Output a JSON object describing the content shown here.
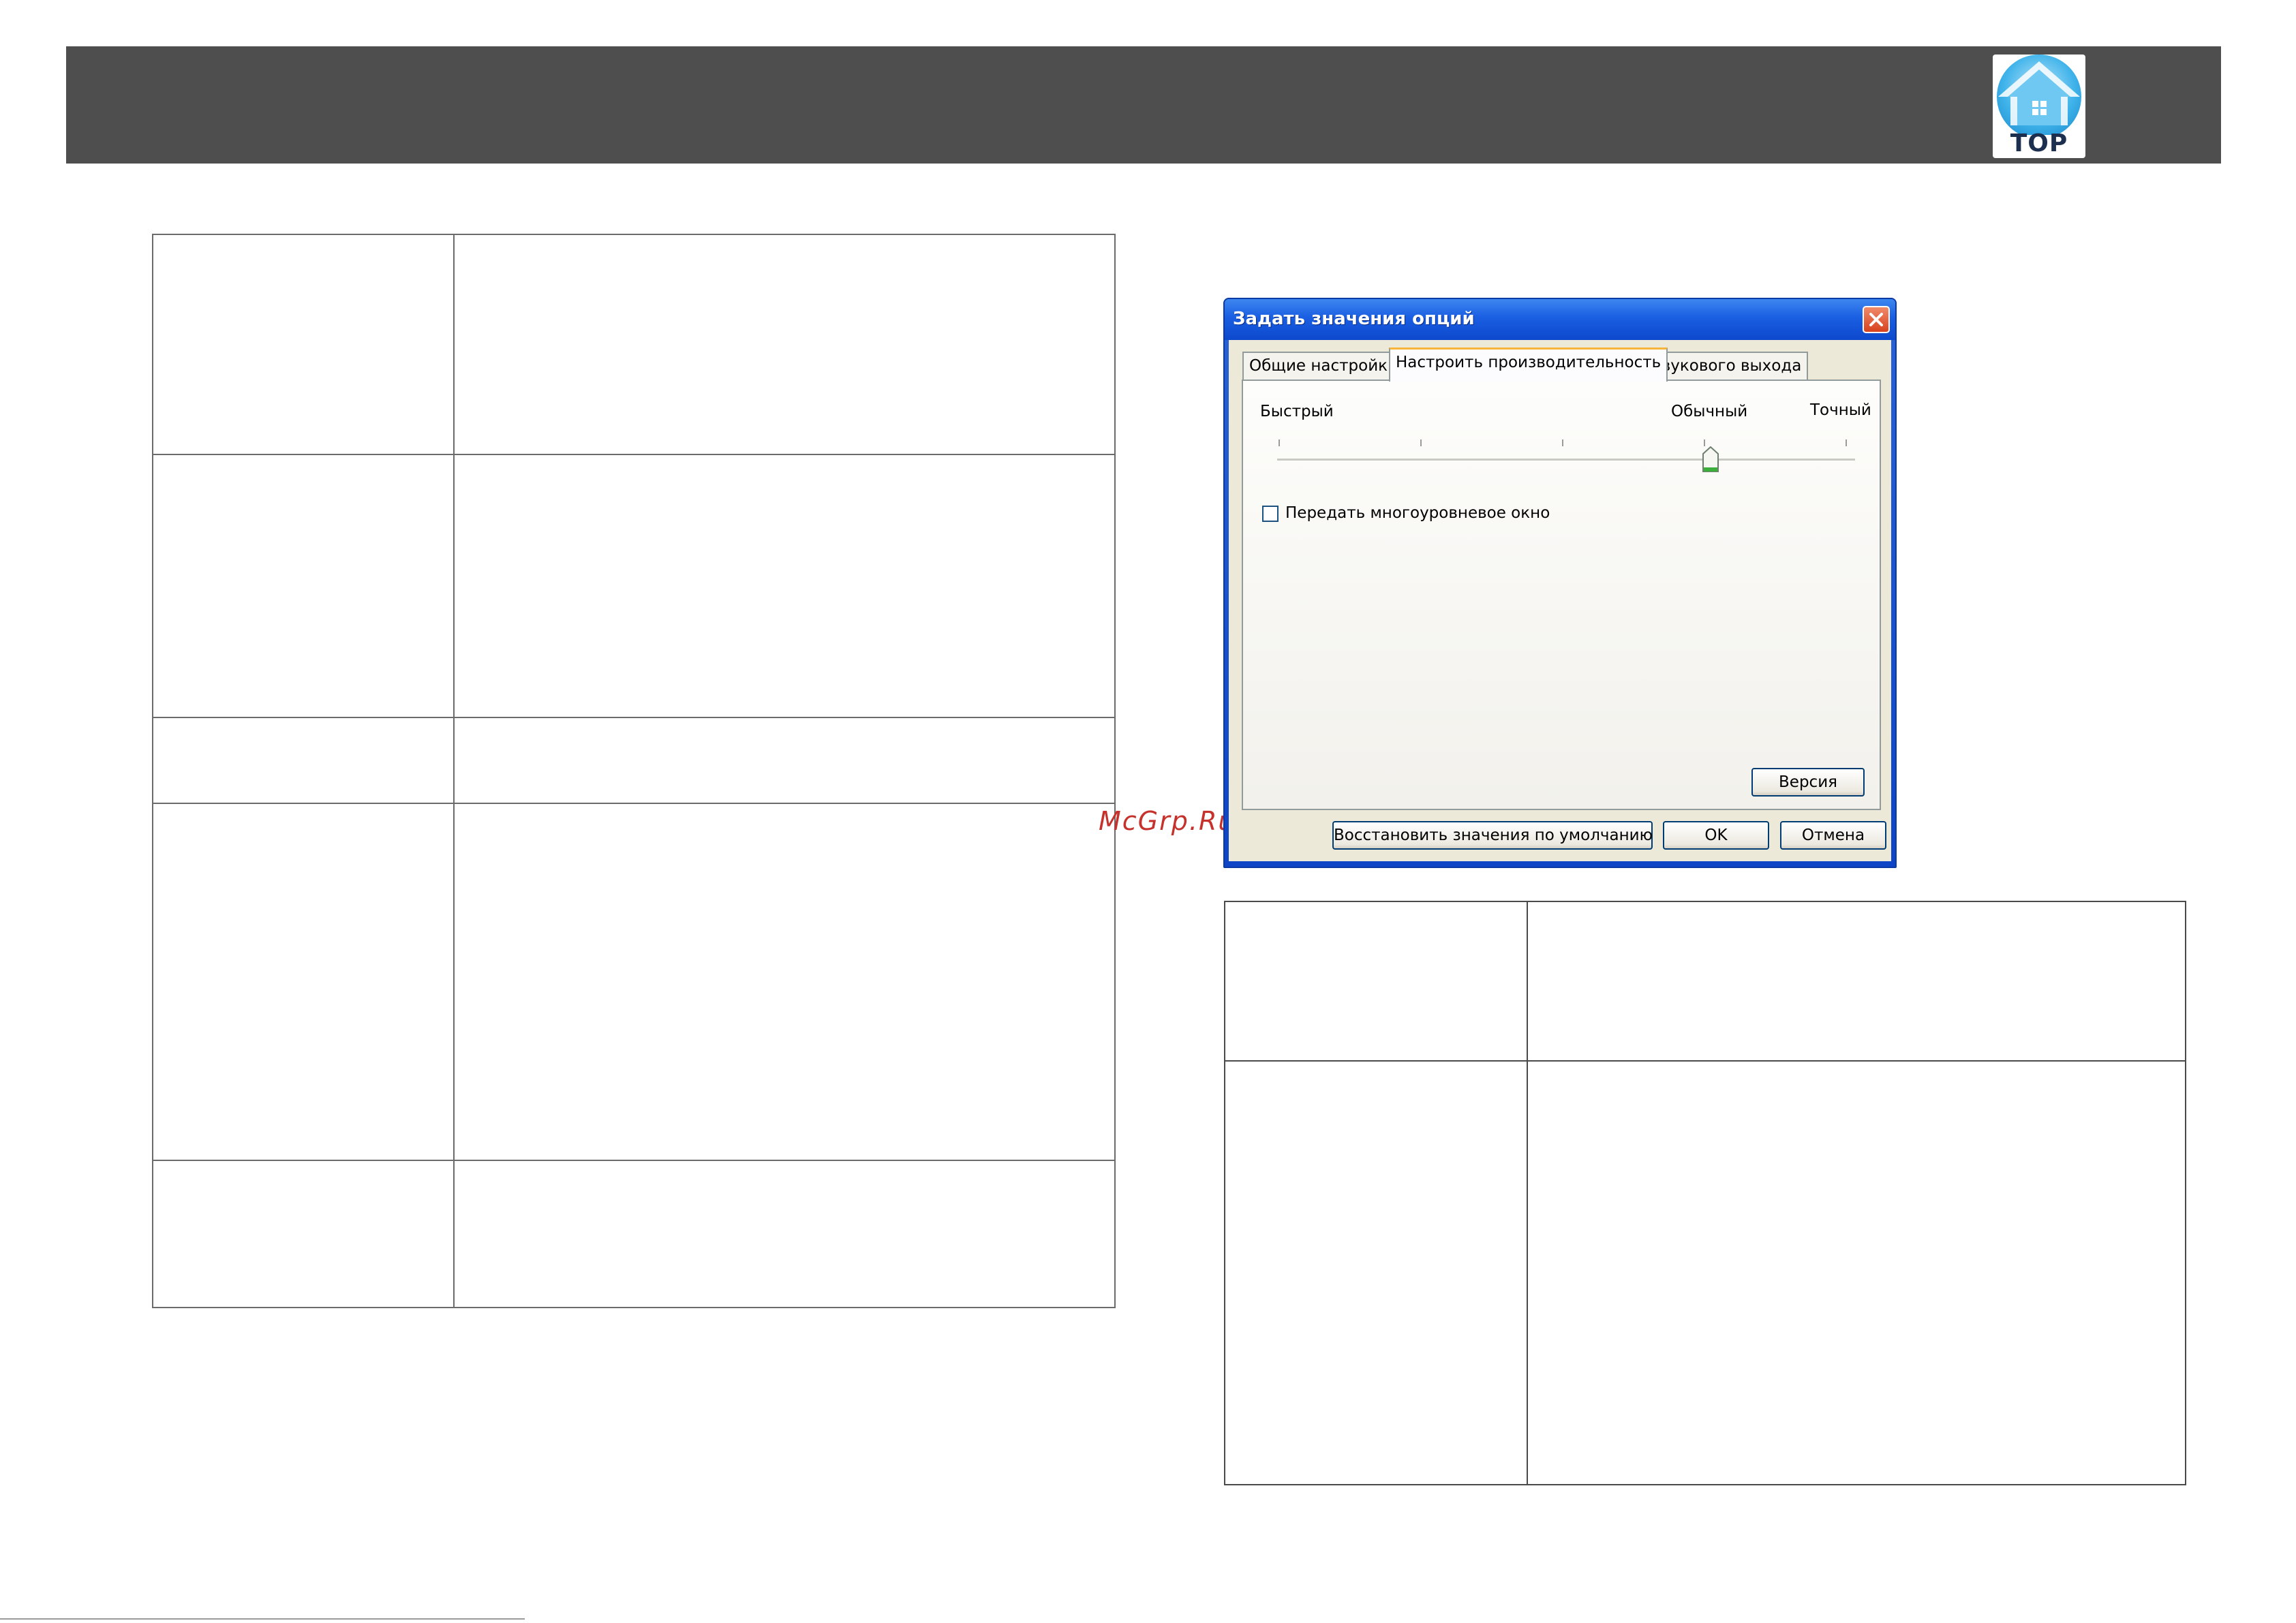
{
  "header": {
    "top_badge_label": "TOP",
    "top_badge_icon": "home-icon",
    "band_color": "#4e4e4e"
  },
  "watermark": "McGrp.Ru",
  "dialog": {
    "title": "Задать значения опций",
    "close_icon": "close-icon",
    "tabs": [
      {
        "label": "Общие настройки",
        "active": false
      },
      {
        "label": "Настроить производительность",
        "active": true
      },
      {
        "label": "Звукового выхода",
        "active": false
      }
    ],
    "slider": {
      "labels": [
        "Быстрый",
        "Обычный",
        "Точный"
      ],
      "selected": "Обычный",
      "positions": 5,
      "selected_index": 3
    },
    "checkbox": {
      "label": "Передать многоуровневое окно",
      "checked": false
    },
    "buttons": {
      "version": "Версия",
      "restore": "Восстановить значения по умолчанию",
      "ok": "OK",
      "cancel": "Отмена"
    },
    "colors": {
      "title_bar": "#1a5ee2",
      "close_button": "#d8421e",
      "active_tab_accent": "#f6b43a",
      "slider_thumb": "#3cae3c"
    }
  }
}
